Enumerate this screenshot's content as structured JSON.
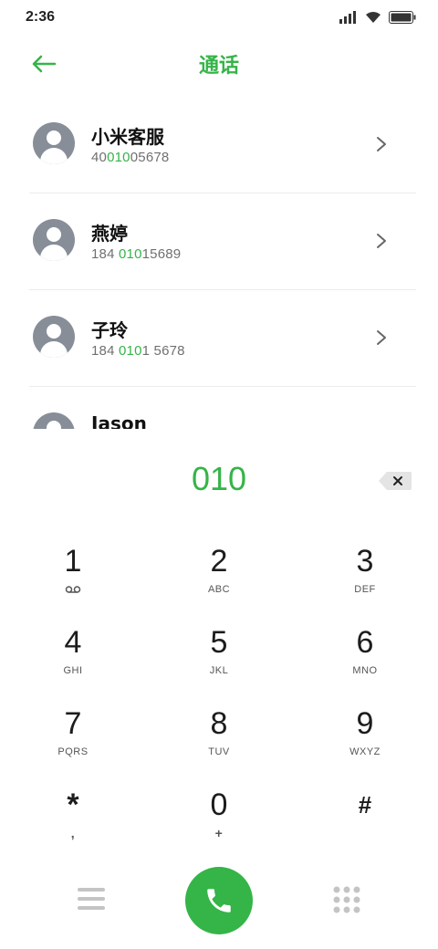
{
  "status_bar": {
    "time": "2:36",
    "icons": [
      "signal-icon",
      "wifi-icon",
      "battery-icon"
    ]
  },
  "header": {
    "title": "通话",
    "back_icon": "arrow-left-icon"
  },
  "colors": {
    "accent": "#35b448",
    "avatar": "#878e98"
  },
  "contacts": [
    {
      "name": "小米客服",
      "number_pre": "40",
      "number_match": "010",
      "number_post": "05678"
    },
    {
      "name": "燕婷",
      "number_pre": "184 ",
      "number_match": "010",
      "number_post": "15689"
    },
    {
      "name": "子玲",
      "number_pre": "184 ",
      "number_match": "010",
      "number_post": "1 5678"
    },
    {
      "name": "Jason",
      "number_pre": "",
      "number_match": "",
      "number_post": ""
    }
  ],
  "dialer": {
    "number": "010"
  },
  "keys": [
    {
      "digit": "1",
      "letters": ""
    },
    {
      "digit": "2",
      "letters": "ABC"
    },
    {
      "digit": "3",
      "letters": "DEF"
    },
    {
      "digit": "4",
      "letters": "GHI"
    },
    {
      "digit": "5",
      "letters": "JKL"
    },
    {
      "digit": "6",
      "letters": "MNO"
    },
    {
      "digit": "7",
      "letters": "PQRS"
    },
    {
      "digit": "8",
      "letters": "TUV"
    },
    {
      "digit": "9",
      "letters": "WXYZ"
    },
    {
      "digit": "*",
      "letters": ","
    },
    {
      "digit": "0",
      "letters": "+"
    },
    {
      "digit": "#",
      "letters": ""
    }
  ]
}
